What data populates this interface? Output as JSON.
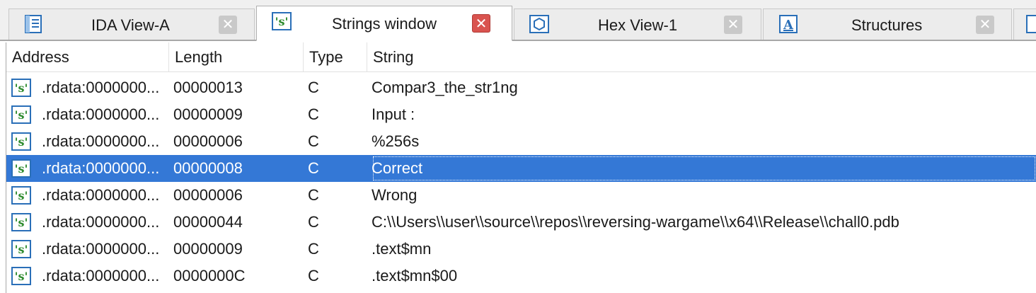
{
  "tabs": [
    {
      "label": "IDA View-A",
      "icon": "disassembly-icon",
      "active": false
    },
    {
      "label": "Strings window",
      "icon": "strings-icon",
      "active": true
    },
    {
      "label": "Hex View-1",
      "icon": "hex-icon",
      "active": false
    },
    {
      "label": "Structures",
      "icon": "structures-icon",
      "active": false
    }
  ],
  "close_glyph": "✕",
  "columns": {
    "address": "Address",
    "length": "Length",
    "type": "Type",
    "string": "String"
  },
  "rows": [
    {
      "address": ".rdata:0000000...",
      "length": "00000013",
      "type": "C",
      "string": "Compar3_the_str1ng"
    },
    {
      "address": ".rdata:0000000...",
      "length": "00000009",
      "type": "C",
      "string": "Input :"
    },
    {
      "address": ".rdata:0000000...",
      "length": "00000006",
      "type": "C",
      "string": "%256s"
    },
    {
      "address": ".rdata:0000000...",
      "length": "00000008",
      "type": "C",
      "string": "Correct"
    },
    {
      "address": ".rdata:0000000...",
      "length": "00000006",
      "type": "C",
      "string": "Wrong"
    },
    {
      "address": ".rdata:0000000...",
      "length": "00000044",
      "type": "C",
      "string": "C:\\\\Users\\\\user\\\\source\\\\repos\\\\reversing-wargame\\\\x64\\\\Release\\\\chall0.pdb"
    },
    {
      "address": ".rdata:0000000...",
      "length": "00000009",
      "type": "C",
      "string": ".text$mn"
    },
    {
      "address": ".rdata:0000000...",
      "length": "0000000C",
      "type": "C",
      "string": ".text$mn$00"
    }
  ],
  "selected_row": 3,
  "colors": {
    "selection": "#3478d6",
    "active_close": "#d9534f",
    "icon_blue": "#2a6fb8",
    "icon_green": "#2e8b2e"
  }
}
